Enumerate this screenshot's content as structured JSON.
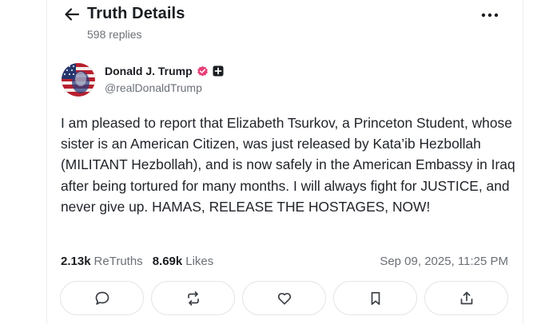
{
  "header": {
    "title": "Truth Details",
    "replies": "598 replies",
    "back_icon": "arrow-left-icon",
    "more_icon": "more-horizontal-icon"
  },
  "post": {
    "author": {
      "display_name": "Donald J. Trump",
      "handle": "@realDonaldTrump",
      "verified_color": "#e64177"
    },
    "text": "I am pleased to report that Elizabeth Tsurkov, a Princeton Student, whose sister is an American Citizen, was just released by Kata’ib Hezbollah (MILITANT Hezbollah), and is now safely in the American Embassy in Iraq after being tortured for many months. I will always fight for JUSTICE, and never give up. HAMAS, RELEASE THE HOSTAGES, NOW!",
    "stats": {
      "retruths_count": "2.13k",
      "retruths_label": "ReTruths",
      "likes_count": "8.69k",
      "likes_label": "Likes"
    },
    "timestamp": "Sep 09, 2025, 11:25 PM"
  },
  "actions": [
    {
      "name": "reply",
      "icon": "comment-icon"
    },
    {
      "name": "retruth",
      "icon": "repost-icon"
    },
    {
      "name": "like",
      "icon": "heart-icon"
    },
    {
      "name": "bookmark",
      "icon": "bookmark-icon"
    },
    {
      "name": "share",
      "icon": "share-icon"
    }
  ]
}
